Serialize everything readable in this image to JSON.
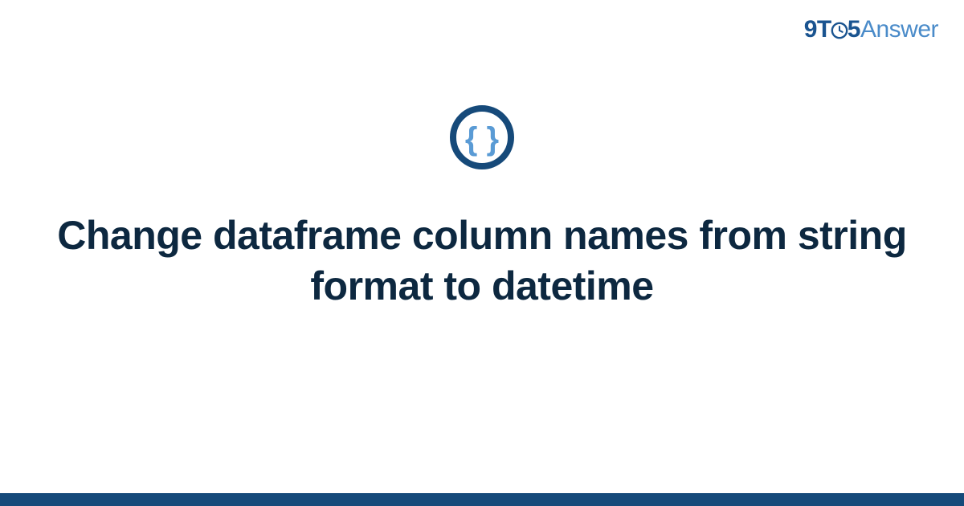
{
  "brand": {
    "prefix": "9T",
    "middle_digit": "5",
    "suffix": "Answer"
  },
  "icon": {
    "name": "code-braces-icon"
  },
  "title": "Change dataframe column names from string format to datetime",
  "colors": {
    "brand_dark": "#1a5490",
    "brand_light": "#4a8bc9",
    "title_color": "#0d2840",
    "bottom_bar": "#164a7a",
    "icon_ring": "#164a7a",
    "icon_brace": "#5a9bd5"
  }
}
